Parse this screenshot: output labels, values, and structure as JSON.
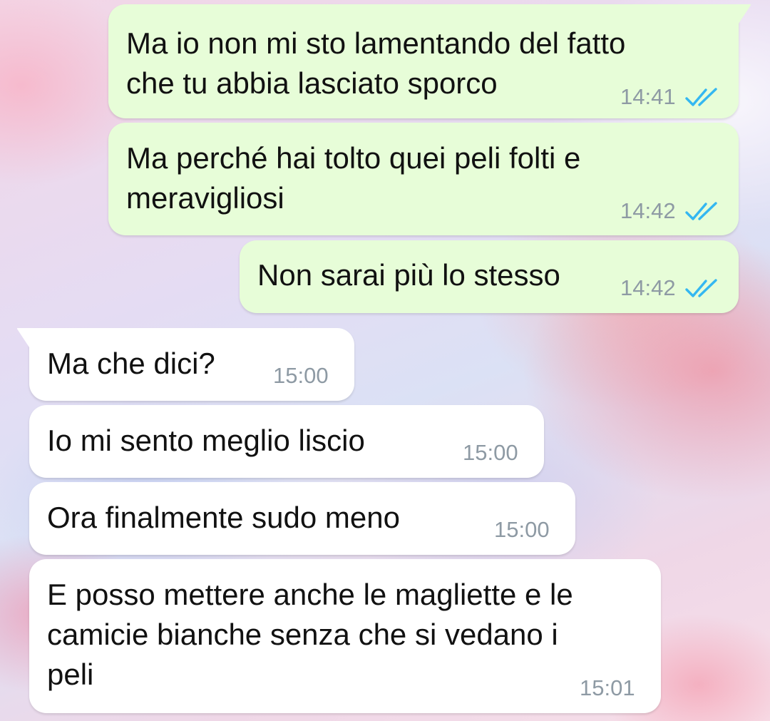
{
  "messages": [
    {
      "direction": "outgoing",
      "lines": [
        "Ma io non mi sto lamentando del fatto",
        "che tu abbia lasciato sporco"
      ],
      "time": "14:41",
      "status_icon": "double-check-icon"
    },
    {
      "direction": "outgoing",
      "lines": [
        "Ma perché hai tolto quei peli folti e",
        "meravigliosi"
      ],
      "time": "14:42",
      "status_icon": "double-check-icon"
    },
    {
      "direction": "outgoing",
      "lines": [
        "Non sarai più lo stesso"
      ],
      "time": "14:42",
      "status_icon": "double-check-icon"
    },
    {
      "direction": "incoming",
      "lines": [
        "Ma che dici?"
      ],
      "time": "15:00"
    },
    {
      "direction": "incoming",
      "lines": [
        "Io mi sento meglio liscio"
      ],
      "time": "15:00"
    },
    {
      "direction": "incoming",
      "lines": [
        "Ora finalmente sudo meno"
      ],
      "time": "15:00"
    },
    {
      "direction": "incoming",
      "lines": [
        "E posso mettere anche le magliette e le",
        "camicie bianche senza che si vedano i",
        "peli"
      ],
      "time": "15:01"
    }
  ],
  "colors": {
    "outgoing_bubble": "#e7fdd8",
    "incoming_bubble": "#ffffff",
    "read_tick": "#34b7f1",
    "timestamp": "#8e9aa4"
  }
}
